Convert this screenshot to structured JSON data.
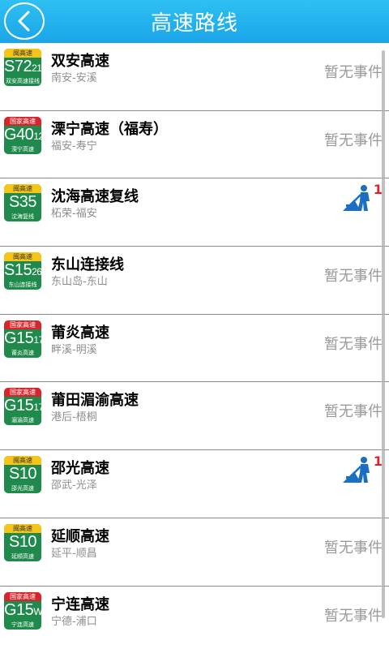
{
  "header": {
    "title": "高速路线",
    "back_icon": "chevron-left-icon"
  },
  "colors": {
    "header": "#1aa5e8",
    "provincial_badge_top": "#f5c518",
    "national_badge_top": "#d8242b",
    "badge_body": "#1f8a4b",
    "event_count": "#d8242b"
  },
  "routes": [
    {
      "badge_type": "provincial",
      "badge_top": "闽高速",
      "code": "S72",
      "code_sub": "21",
      "badge_name": "双安高速接线",
      "title": "双安高速",
      "subtitle": "南安-安溪",
      "status": "暂无事件"
    },
    {
      "badge_type": "national",
      "badge_top": "国家高速",
      "code": "G40",
      "code_sub": "12",
      "badge_name": "溧宁高速",
      "title": "溧宁高速（福寿）",
      "subtitle": "福安-寿宁",
      "status": "暂无事件"
    },
    {
      "badge_type": "provincial",
      "badge_top": "闽高速",
      "code": "S35",
      "code_sub": "",
      "badge_name": "沈海复线",
      "title": "沈海高速复线",
      "subtitle": "柘荣-福安",
      "event_count": "1"
    },
    {
      "badge_type": "provincial",
      "badge_top": "闽高速",
      "code": "S15",
      "code_sub": "26",
      "badge_name": "东山连接线",
      "title": "东山连接线",
      "subtitle": "东山岛-东山",
      "status": "暂无事件"
    },
    {
      "badge_type": "national",
      "badge_top": "国家高速",
      "code": "G15",
      "code_sub": "17",
      "badge_name": "莆炎高速",
      "title": "莆炎高速",
      "subtitle": "畔溪-明溪",
      "status": "暂无事件"
    },
    {
      "badge_type": "national",
      "badge_top": "国家高速",
      "code": "G15",
      "code_sub": "17",
      "badge_name": "湄渝高速",
      "title": "莆田湄渝高速",
      "subtitle": "港后-梧桐",
      "status": "暂无事件"
    },
    {
      "badge_type": "provincial",
      "badge_top": "闽高速",
      "code": "S10",
      "code_sub": "",
      "badge_name": "邵光高速",
      "title": "邵光高速",
      "subtitle": "邵武-光泽",
      "event_count": "1"
    },
    {
      "badge_type": "provincial",
      "badge_top": "闽高速",
      "code": "S10",
      "code_sub": "",
      "badge_name": "延顺高速",
      "title": "延顺高速",
      "subtitle": "延平-顺昌",
      "status": "暂无事件"
    },
    {
      "badge_type": "national",
      "badge_top": "国家高速",
      "code": "G15",
      "code_sub": "W3",
      "badge_name": "宁连高速",
      "title": "宁连高速",
      "subtitle": "宁德-浦口",
      "status": "暂无事件"
    }
  ]
}
